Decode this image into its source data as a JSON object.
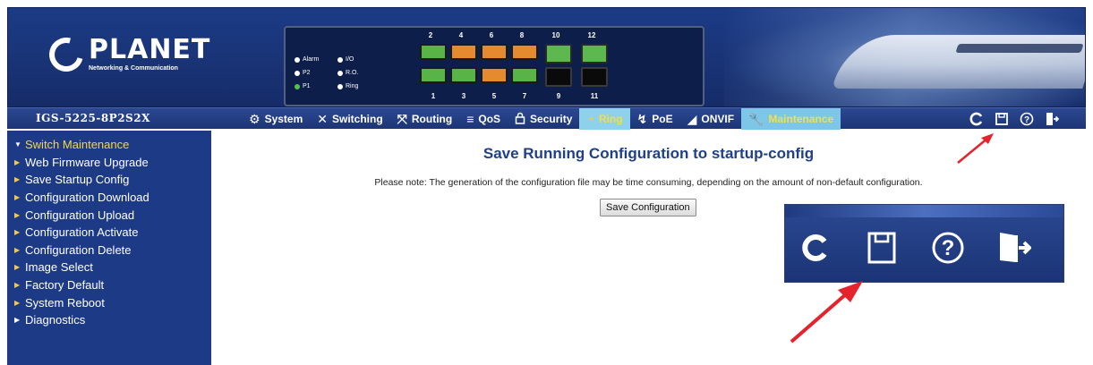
{
  "header": {
    "brand": "PLANET",
    "brand_sub": "Networking & Communication",
    "model": "IGS-5225-8P2S2X"
  },
  "panel": {
    "leds": [
      {
        "label": "Alarm",
        "color": "#ffffff"
      },
      {
        "label": "I/O",
        "color": "#ffffff"
      },
      {
        "label": "P2",
        "color": "#ffffff"
      },
      {
        "label": "R.O.",
        "color": "#ffffff"
      },
      {
        "label": "P1",
        "color": "#53c24a"
      },
      {
        "label": "Ring",
        "color": "#ffffff"
      }
    ],
    "top_ports": [
      "2",
      "4",
      "6",
      "8",
      "10",
      "12"
    ],
    "bottom_ports": [
      "1",
      "3",
      "5",
      "7",
      "9",
      "11"
    ]
  },
  "menu": {
    "items": [
      {
        "label": "System",
        "icon": "gear-icon"
      },
      {
        "label": "Switching",
        "icon": "switching-icon"
      },
      {
        "label": "Routing",
        "icon": "routing-icon"
      },
      {
        "label": "QoS",
        "icon": "qos-icon"
      },
      {
        "label": "Security",
        "icon": "lock-icon"
      },
      {
        "label": "Ring",
        "icon": "ring-icon"
      },
      {
        "label": "PoE",
        "icon": "poe-icon"
      },
      {
        "label": "ONVIF",
        "icon": "camera-icon"
      },
      {
        "label": "Maintenance",
        "icon": "wrench-icon"
      }
    ],
    "tools": [
      "refresh-icon",
      "save-icon",
      "help-icon",
      "logout-icon"
    ]
  },
  "sidebar": {
    "items": [
      "Switch Maintenance",
      "Web Firmware Upgrade",
      "Save Startup Config",
      "Configuration Download",
      "Configuration Upload",
      "Configuration Activate",
      "Configuration Delete",
      "Image Select",
      "Factory Default",
      "System Reboot",
      "Diagnostics"
    ]
  },
  "main": {
    "title": "Save Running Configuration to startup-config",
    "note": "Please note: The generation of the configuration file may be time consuming, depending on the amount of non-default configuration.",
    "button": "Save Configuration"
  },
  "colors": {
    "brand_blue": "#1d3a86",
    "title_blue": "#1f3f88",
    "active_tab": "#7ec6e8",
    "highlight_yellow": "#f2d848",
    "arrow_red": "#e5232c"
  }
}
